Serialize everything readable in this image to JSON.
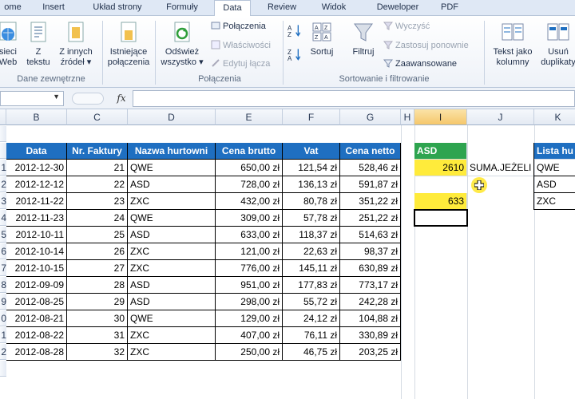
{
  "ribbon_tabs": [
    "ome",
    "Insert",
    "Układ strony",
    "Formuły",
    "Data",
    "Review",
    "Widok",
    "Deweloper",
    "PDF"
  ],
  "active_tab": "Data",
  "ribbon": {
    "web_label_1": "sieci",
    "web_label_2": "Web",
    "text_label_1": "Z",
    "text_label_2": "tekstu",
    "other_label_1": "Z innych",
    "other_label_2": "źródeł",
    "existing_label_1": "Istniejące",
    "existing_label_2": "połączenia",
    "group_external": "Dane zewnętrzne",
    "refresh_label_1": "Odśwież",
    "refresh_label_2": "wszystko",
    "connections": "Połączenia",
    "properties": "Właściwości",
    "edit_links": "Edytuj łącza",
    "group_connections": "Połączenia",
    "sort_label": "Sortuj",
    "filter_label": "Filtruj",
    "clear": "Wyczyść",
    "reapply": "Zastosuj ponownie",
    "advanced": "Zaawansowane",
    "group_sort_filter": "Sortowanie i filtrowanie",
    "text_to_cols_1": "Tekst jako",
    "text_to_cols_2": "kolumny",
    "remove_dup_1": "Usuń",
    "remove_dup_2": "duplikaty"
  },
  "formula_bar": {
    "fx": "fx",
    "formula": ""
  },
  "columns": [
    "B",
    "C",
    "D",
    "E",
    "F",
    "G",
    "H",
    "I",
    "J",
    "K"
  ],
  "row_numbers": [
    "1",
    "2",
    "3",
    "4",
    "5",
    "6",
    "7",
    "8",
    "9",
    "0",
    "1",
    "2"
  ],
  "table_headers": [
    "Data",
    "Nr. Faktury",
    "Nazwa hurtowni",
    "Cena brutto",
    "Vat",
    "Cena netto"
  ],
  "table_rows": [
    [
      "2012-12-30",
      "21",
      "QWE",
      "650,00 zł",
      "121,54 zł",
      "528,46 zł"
    ],
    [
      "2012-12-12",
      "22",
      "ASD",
      "728,00 zł",
      "136,13 zł",
      "591,87 zł"
    ],
    [
      "2012-11-22",
      "23",
      "ZXC",
      "432,00 zł",
      "80,78 zł",
      "351,22 zł"
    ],
    [
      "2012-11-23",
      "24",
      "QWE",
      "309,00 zł",
      "57,78 zł",
      "251,22 zł"
    ],
    [
      "2012-10-11",
      "25",
      "ASD",
      "633,00 zł",
      "118,37 zł",
      "514,63 zł"
    ],
    [
      "2012-10-14",
      "26",
      "ZXC",
      "121,00 zł",
      "22,63 zł",
      "98,37 zł"
    ],
    [
      "2012-10-15",
      "27",
      "ZXC",
      "776,00 zł",
      "145,11 zł",
      "630,89 zł"
    ],
    [
      "2012-09-09",
      "28",
      "ASD",
      "951,00 zł",
      "177,83 zł",
      "773,17 zł"
    ],
    [
      "2012-08-25",
      "29",
      "ASD",
      "298,00 zł",
      "55,72 zł",
      "242,28 zł"
    ],
    [
      "2012-08-21",
      "30",
      "QWE",
      "129,00 zł",
      "24,12 zł",
      "104,88 zł"
    ],
    [
      "2012-08-22",
      "31",
      "ZXC",
      "407,00 zł",
      "76,11 zł",
      "330,89 zł"
    ],
    [
      "2012-08-28",
      "32",
      "ZXC",
      "250,00 zł",
      "46,75 zł",
      "203,25 zł"
    ]
  ],
  "side": {
    "asd_header": "ASD",
    "sum_value": "2610",
    "sum_label": "SUMA.JEŻELI",
    "second_value": "633",
    "list_header": "Lista hu",
    "list_items": [
      "QWE",
      "ASD",
      "ZXC"
    ]
  },
  "colors": {
    "table_header": "#1f6fc1",
    "criteria_header": "#2ea44f",
    "highlight": "#ffeb3b"
  }
}
